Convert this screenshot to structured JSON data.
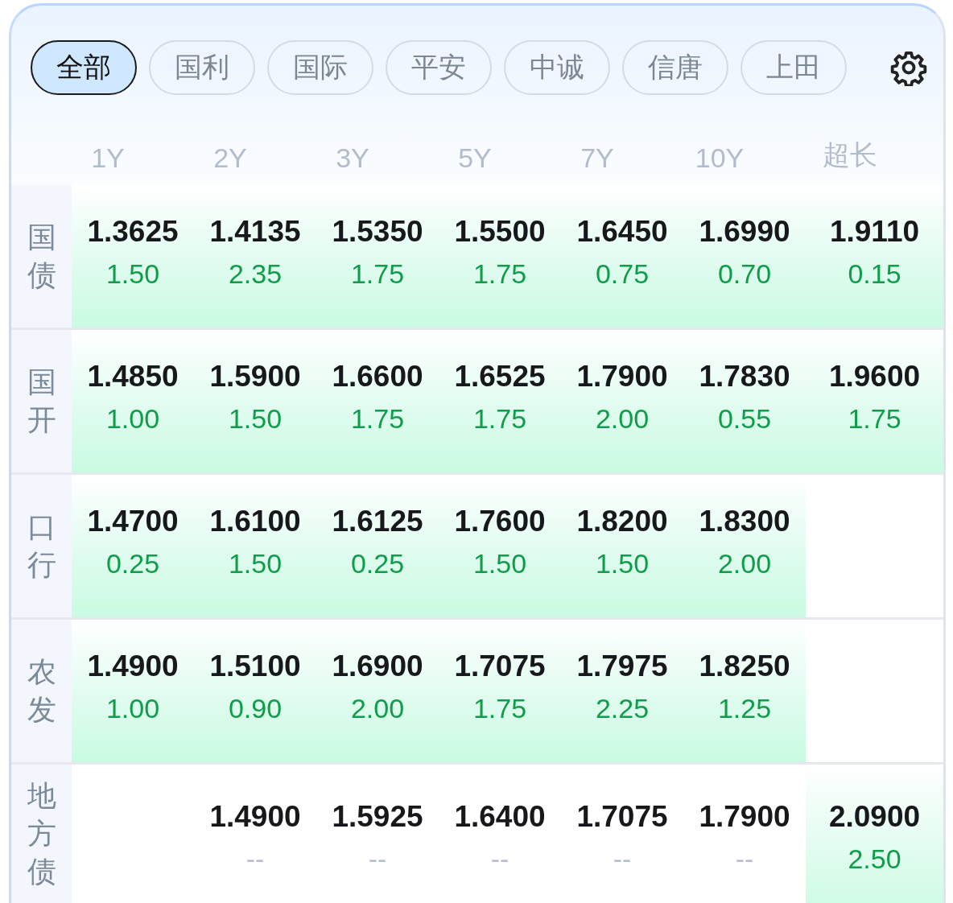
{
  "tabs": [
    {
      "label": "全部",
      "selected": true
    },
    {
      "label": "国利",
      "selected": false
    },
    {
      "label": "国际",
      "selected": false
    },
    {
      "label": "平安",
      "selected": false
    },
    {
      "label": "中诚",
      "selected": false
    },
    {
      "label": "信唐",
      "selected": false
    },
    {
      "label": "上田",
      "selected": false
    }
  ],
  "columns": [
    "1Y",
    "2Y",
    "3Y",
    "5Y",
    "7Y",
    "10Y",
    "超长"
  ],
  "rows": [
    {
      "label": "国债",
      "cells": [
        {
          "value": "1.3625",
          "change": "1.50",
          "kind": "quote",
          "highlighted": true
        },
        {
          "value": "1.4135",
          "change": "2.35",
          "kind": "quote",
          "highlighted": true
        },
        {
          "value": "1.5350",
          "change": "1.75",
          "kind": "quote",
          "highlighted": true
        },
        {
          "value": "1.5500",
          "change": "1.75",
          "kind": "quote",
          "highlighted": true
        },
        {
          "value": "1.6450",
          "change": "0.75",
          "kind": "quote",
          "highlighted": true
        },
        {
          "value": "1.6990",
          "change": "0.70",
          "kind": "quote",
          "highlighted": true
        },
        {
          "value": "1.9110",
          "change": "0.15",
          "kind": "quote",
          "highlighted": true
        }
      ]
    },
    {
      "label": "国开",
      "cells": [
        {
          "value": "1.4850",
          "change": "1.00",
          "kind": "quote",
          "highlighted": true
        },
        {
          "value": "1.5900",
          "change": "1.50",
          "kind": "quote",
          "highlighted": true
        },
        {
          "value": "1.6600",
          "change": "1.75",
          "kind": "quote",
          "highlighted": true
        },
        {
          "value": "1.6525",
          "change": "1.75",
          "kind": "quote",
          "highlighted": true
        },
        {
          "value": "1.7900",
          "change": "2.00",
          "kind": "quote",
          "highlighted": true
        },
        {
          "value": "1.7830",
          "change": "0.55",
          "kind": "quote",
          "highlighted": true
        },
        {
          "value": "1.9600",
          "change": "1.75",
          "kind": "quote",
          "highlighted": true
        }
      ]
    },
    {
      "label": "口行",
      "cells": [
        {
          "value": "1.4700",
          "change": "0.25",
          "kind": "quote",
          "highlighted": true
        },
        {
          "value": "1.6100",
          "change": "1.50",
          "kind": "quote",
          "highlighted": true
        },
        {
          "value": "1.6125",
          "change": "0.25",
          "kind": "quote",
          "highlighted": true
        },
        {
          "value": "1.7600",
          "change": "1.50",
          "kind": "quote",
          "highlighted": true
        },
        {
          "value": "1.8200",
          "change": "1.50",
          "kind": "quote",
          "highlighted": true
        },
        {
          "value": "1.8300",
          "change": "2.00",
          "kind": "quote",
          "highlighted": true
        },
        null
      ]
    },
    {
      "label": "农发",
      "cells": [
        {
          "value": "1.4900",
          "change": "1.00",
          "kind": "quote",
          "highlighted": true
        },
        {
          "value": "1.5100",
          "change": "0.90",
          "kind": "quote",
          "highlighted": true
        },
        {
          "value": "1.6900",
          "change": "2.00",
          "kind": "quote",
          "highlighted": true
        },
        {
          "value": "1.7075",
          "change": "1.75",
          "kind": "quote",
          "highlighted": true
        },
        {
          "value": "1.7975",
          "change": "2.25",
          "kind": "quote",
          "highlighted": true
        },
        {
          "value": "1.8250",
          "change": "1.25",
          "kind": "quote",
          "highlighted": true
        },
        null
      ]
    },
    {
      "label": "地方债",
      "cells": [
        null,
        {
          "value": "1.4900",
          "change": "--",
          "kind": "empty",
          "highlighted": false
        },
        {
          "value": "1.5925",
          "change": "--",
          "kind": "empty",
          "highlighted": false
        },
        {
          "value": "1.6400",
          "change": "--",
          "kind": "empty",
          "highlighted": false
        },
        {
          "value": "1.7075",
          "change": "--",
          "kind": "empty",
          "highlighted": false
        },
        {
          "value": "1.7900",
          "change": "--",
          "kind": "empty",
          "highlighted": false
        },
        {
          "value": "2.0900",
          "change": "2.50",
          "kind": "quote",
          "highlighted": true
        }
      ]
    }
  ]
}
